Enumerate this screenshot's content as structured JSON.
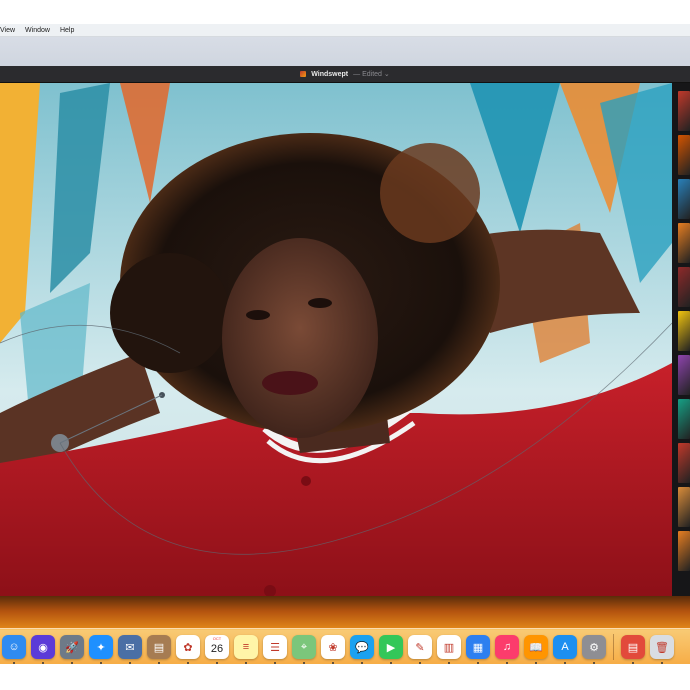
{
  "menubar": {
    "items": [
      "View",
      "Window",
      "Help"
    ]
  },
  "window": {
    "title": "Windswept",
    "status": "— Edited ⌄"
  },
  "photo": {
    "subject": "portrait"
  },
  "filmstrip": {
    "thumb_colors": [
      "#c0392b",
      "#d35400",
      "#2980b9",
      "#e67e22",
      "#8e2a2a",
      "#f1c40f",
      "#8e44ad",
      "#16a085",
      "#c0392b",
      "#d98c3a",
      "#e67e22"
    ]
  },
  "dock": {
    "calendar": {
      "month": "OCT",
      "day": "26"
    },
    "apps": [
      {
        "name": "finder-icon",
        "color": "#2f8bf0",
        "glyph": "☺"
      },
      {
        "name": "siri-icon",
        "color": "#5b3bd8",
        "glyph": "◉"
      },
      {
        "name": "launchpad-icon",
        "color": "#6e7a88",
        "glyph": "🚀"
      },
      {
        "name": "safari-icon",
        "color": "#1e90ff",
        "glyph": "✦"
      },
      {
        "name": "mail-stamp-icon",
        "color": "#4a6fa5",
        "glyph": "✉"
      },
      {
        "name": "notes-folder-icon",
        "color": "#a67c52",
        "glyph": "▤"
      },
      {
        "name": "photos-icon",
        "color": "#ffffff",
        "glyph": "✿"
      },
      {
        "name": "calendar-icon",
        "color": "#ffffff",
        "glyph": ""
      },
      {
        "name": "notes-icon",
        "color": "#fff5a8",
        "glyph": "≡"
      },
      {
        "name": "reminders-icon",
        "color": "#ffffff",
        "glyph": "☰"
      },
      {
        "name": "maps-icon",
        "color": "#7bc67b",
        "glyph": "⌖"
      },
      {
        "name": "photo-booth-icon",
        "color": "#ffffff",
        "glyph": "❀"
      },
      {
        "name": "messages-icon",
        "color": "#1aa1f0",
        "glyph": "💬"
      },
      {
        "name": "facetime-icon",
        "color": "#33c759",
        "glyph": "▶"
      },
      {
        "name": "keynote-icon",
        "color": "#ffffff",
        "glyph": "✎"
      },
      {
        "name": "numbers-icon",
        "color": "#ffffff",
        "glyph": "▥"
      },
      {
        "name": "keynote-podium-icon",
        "color": "#2d7ff0",
        "glyph": "▦"
      },
      {
        "name": "itunes-icon",
        "color": "#fc3c6c",
        "glyph": "♫"
      },
      {
        "name": "ibooks-icon",
        "color": "#ff9500",
        "glyph": "📖"
      },
      {
        "name": "app-store-icon",
        "color": "#1c8ff0",
        "glyph": "A"
      },
      {
        "name": "system-preferences-icon",
        "color": "#8e8e93",
        "glyph": "⚙"
      }
    ],
    "right_items": [
      {
        "name": "downloads-stack-icon",
        "color": "#e24a3b",
        "glyph": "▤"
      },
      {
        "name": "trash-icon",
        "color": "#d9dde2",
        "glyph": "🗑"
      }
    ]
  }
}
